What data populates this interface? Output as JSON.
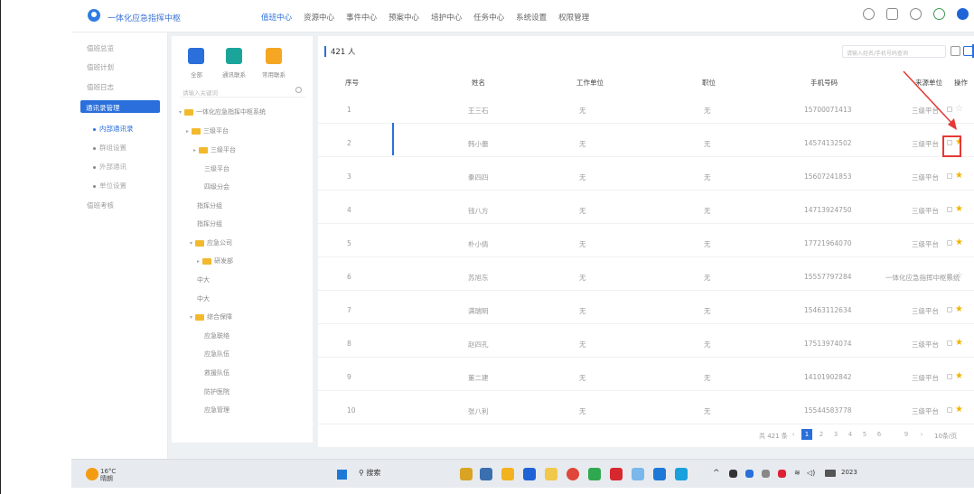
{
  "app": {
    "title": "一体化应急指挥中枢"
  },
  "nav": [
    "值班中心",
    "资源中心",
    "事件中心",
    "预案中心",
    "培护中心",
    "任务中心",
    "系统设置",
    "权限管理"
  ],
  "left_menu": [
    {
      "label": "值班总览"
    },
    {
      "label": "值班计划"
    },
    {
      "label": "值班日志"
    },
    {
      "label": "通讯录管理",
      "active": true
    },
    {
      "label": "内部通讯录",
      "sub": true,
      "active": true
    },
    {
      "label": "群组设置",
      "sub": true
    },
    {
      "label": "外部通讯",
      "sub": true
    },
    {
      "label": "单位设置",
      "sub": true
    },
    {
      "label": "值班考核"
    }
  ],
  "tree": {
    "buttons": [
      "全部",
      "通讯联系",
      "常用联系"
    ],
    "search_placeholder": "请输入关键词",
    "nodes": [
      {
        "label": "一体化应急指挥中枢系统",
        "folder": true
      },
      {
        "label": "三级平台",
        "folder": true
      },
      {
        "label": "三级平台",
        "folder": true
      },
      {
        "label": "三级平台"
      },
      {
        "label": "四级分会"
      },
      {
        "label": "指挥分组"
      },
      {
        "label": "指挥分组"
      },
      {
        "label": "应急公司",
        "folder": true
      },
      {
        "label": "研发部",
        "folder": true
      },
      {
        "label": "中大"
      },
      {
        "label": "中大"
      },
      {
        "label": "综合保障",
        "folder": true
      },
      {
        "label": "应急联络"
      },
      {
        "label": "应急队伍"
      },
      {
        "label": "救援队伍"
      },
      {
        "label": "防护医院"
      },
      {
        "label": "应急管理"
      }
    ]
  },
  "main": {
    "count": "421 人",
    "search_placeholder": "请输入姓名/手机号码查询",
    "columns": [
      "序号",
      "姓名",
      "工作单位",
      "职位",
      "手机号码",
      "来源单位",
      "操作"
    ],
    "rows": [
      {
        "no": "1",
        "name": "王三石",
        "unit": "无",
        "pos": "无",
        "phone": "15700071413",
        "src": "三级平台",
        "starred": false
      },
      {
        "no": "2",
        "name": "韩小蕾",
        "unit": "无",
        "pos": "无",
        "phone": "14574132502",
        "src": "三级平台",
        "starred": true
      },
      {
        "no": "3",
        "name": "秦四四",
        "unit": "无",
        "pos": "无",
        "phone": "15607241853",
        "src": "三级平台",
        "starred": true
      },
      {
        "no": "4",
        "name": "钱八方",
        "unit": "无",
        "pos": "无",
        "phone": "14713924750",
        "src": "三级平台",
        "starred": true
      },
      {
        "no": "5",
        "name": "朴小倩",
        "unit": "无",
        "pos": "无",
        "phone": "17721964070",
        "src": "三级平台",
        "starred": true
      },
      {
        "no": "6",
        "name": "苏旭东",
        "unit": "无",
        "pos": "无",
        "phone": "15557797284",
        "src": "一体化应急指挥中枢系统",
        "starred": false
      },
      {
        "no": "7",
        "name": "满瑞明",
        "unit": "无",
        "pos": "无",
        "phone": "15463112634",
        "src": "三级平台",
        "starred": true
      },
      {
        "no": "8",
        "name": "赵四孔",
        "unit": "无",
        "pos": "无",
        "phone": "17513974074",
        "src": "三级平台",
        "starred": true
      },
      {
        "no": "9",
        "name": "董二建",
        "unit": "无",
        "pos": "无",
        "phone": "14101902842",
        "src": "三级平台",
        "starred": true
      },
      {
        "no": "10",
        "name": "张八利",
        "unit": "无",
        "pos": "无",
        "phone": "15544583778",
        "src": "三级平台",
        "starred": true
      }
    ],
    "pagination": {
      "total": "共 421 条",
      "pages": [
        "1",
        "2",
        "3",
        "4",
        "5",
        "6",
        "9"
      ],
      "current": "1",
      "size": "10条/页"
    }
  },
  "taskbar": {
    "weather_temp": "16°C",
    "weather_desc": "晴朗",
    "search": "搜索",
    "year": "2023"
  },
  "colors": {
    "accent": "#2a6fdb",
    "star": "#f0b400",
    "highlight": "#e53935"
  }
}
